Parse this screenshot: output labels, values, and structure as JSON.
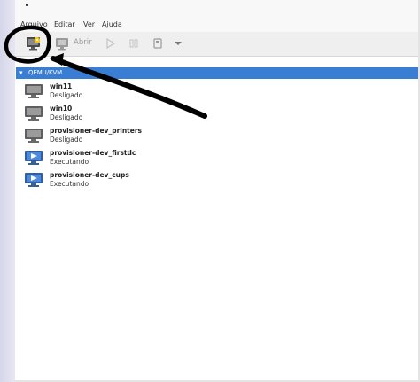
{
  "window": {
    "title_glyph": "\""
  },
  "menu": {
    "items": [
      "Arquivo",
      "Editar",
      "Ver",
      "Ajuda"
    ]
  },
  "toolbar": {
    "new_vm_icon": "new-vm-icon",
    "open_label": "Abrir",
    "open_icon": "monitor-icon",
    "run_icon": "play-icon",
    "pause_icon": "pause-icon",
    "shutdown_icon": "power-icon",
    "menu_icon": "chevron-down-icon"
  },
  "connection": {
    "label": "QEMU/KVM",
    "color": "#3a7ed4"
  },
  "vms": [
    {
      "name": "win11",
      "status": "Desligado",
      "state": "off"
    },
    {
      "name": "win10",
      "status": "Desligado",
      "state": "off"
    },
    {
      "name": "provisioner-dev_printers",
      "status": "Desligado",
      "state": "off"
    },
    {
      "name": "provisioner-dev_firstdc",
      "status": "Executando",
      "state": "running"
    },
    {
      "name": "provisioner-dev_cups",
      "status": "Executando",
      "state": "running"
    }
  ],
  "annotation": {
    "description_icon": "hand-drawn-circle-and-arrow",
    "color": "#000000"
  }
}
